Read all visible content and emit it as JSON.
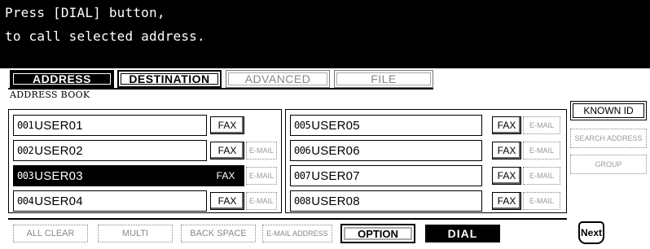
{
  "message": {
    "line1": "Press [DIAL] button,",
    "line2": "to call selected address."
  },
  "tabs": [
    {
      "label": "ADDRESS",
      "state": "active"
    },
    {
      "label": "DESTINATION",
      "state": "normal"
    },
    {
      "label": "ADVANCED",
      "state": "disabled"
    },
    {
      "label": "FILE",
      "state": "disabled"
    }
  ],
  "section_label": "ADDRESS BOOK",
  "entries": [
    {
      "num": "001",
      "name": "USER01",
      "fax": "FAX",
      "email": "",
      "selected": false
    },
    {
      "num": "002",
      "name": "USER02",
      "fax": "FAX",
      "email": "E-MAIL",
      "selected": false
    },
    {
      "num": "003",
      "name": "USER03",
      "fax": "FAX",
      "email": "E-MAIL",
      "selected": true
    },
    {
      "num": "004",
      "name": "USER04",
      "fax": "FAX",
      "email": "E-MAIL",
      "selected": false
    },
    {
      "num": "005",
      "name": "USER05",
      "fax": "FAX",
      "email": "E-MAIL",
      "selected": false
    },
    {
      "num": "006",
      "name": "USER06",
      "fax": "FAX",
      "email": "E-MAIL",
      "selected": false
    },
    {
      "num": "007",
      "name": "USER07",
      "fax": "FAX",
      "email": "E-MAIL",
      "selected": false
    },
    {
      "num": "008",
      "name": "USER08",
      "fax": "FAX",
      "email": "E-MAIL",
      "selected": false
    }
  ],
  "side_buttons": {
    "known_id": "KNOWN ID",
    "search_address": "SEARCH ADDRESS",
    "group": "GROUP"
  },
  "bottom_bar": {
    "all_clear": "ALL CLEAR",
    "multi": "MULTI",
    "back_space": "BACK SPACE",
    "email_address": "E-MAIL ADDRESS",
    "option": "OPTION",
    "dial": "DIAL",
    "next": "Next"
  }
}
